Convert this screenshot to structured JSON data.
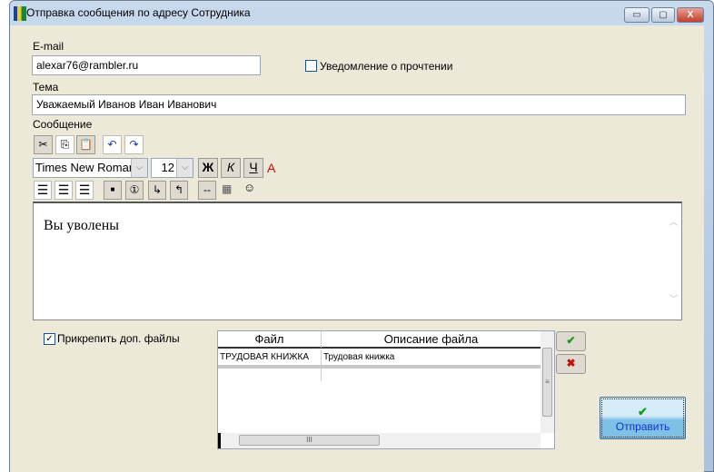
{
  "window": {
    "title": "Отправка сообщения по адресу Сотрудника",
    "minimize": "▭",
    "maximize": "▢",
    "close": "X"
  },
  "email": {
    "label": "E-mail",
    "value": "alexar76@rambler.ru"
  },
  "read_receipt": {
    "label": "Уведомление о прочтении",
    "checked": false
  },
  "subject": {
    "label": "Тема",
    "value": "Уважаемый Иванов Иван Иванович"
  },
  "message": {
    "label": "Сообщение",
    "body": "Вы уволены"
  },
  "toolbar": {
    "font": "Times New Roman",
    "size": "12",
    "bold": "Ж",
    "italic": "К",
    "underline": "Ч",
    "color": "A",
    "hr": "--",
    "numbered": "①",
    "bullet": "■",
    "smiley": "☺"
  },
  "attach": {
    "label": "Прикрепить доп. файлы",
    "checked": true,
    "columns": [
      "Файл",
      "Описание файла"
    ],
    "rows": [
      [
        "ТРУДОВАЯ КНИЖКА",
        "Трудовая книжка"
      ]
    ],
    "scroll_mid": "III"
  },
  "buttons": {
    "send": "Отправить",
    "add": "✔",
    "remove": "✖",
    "send_icon": "✔"
  },
  "colors": {
    "client": "#ece9d8",
    "send": "#8fc8e8",
    "accent_red": "#e00000"
  }
}
